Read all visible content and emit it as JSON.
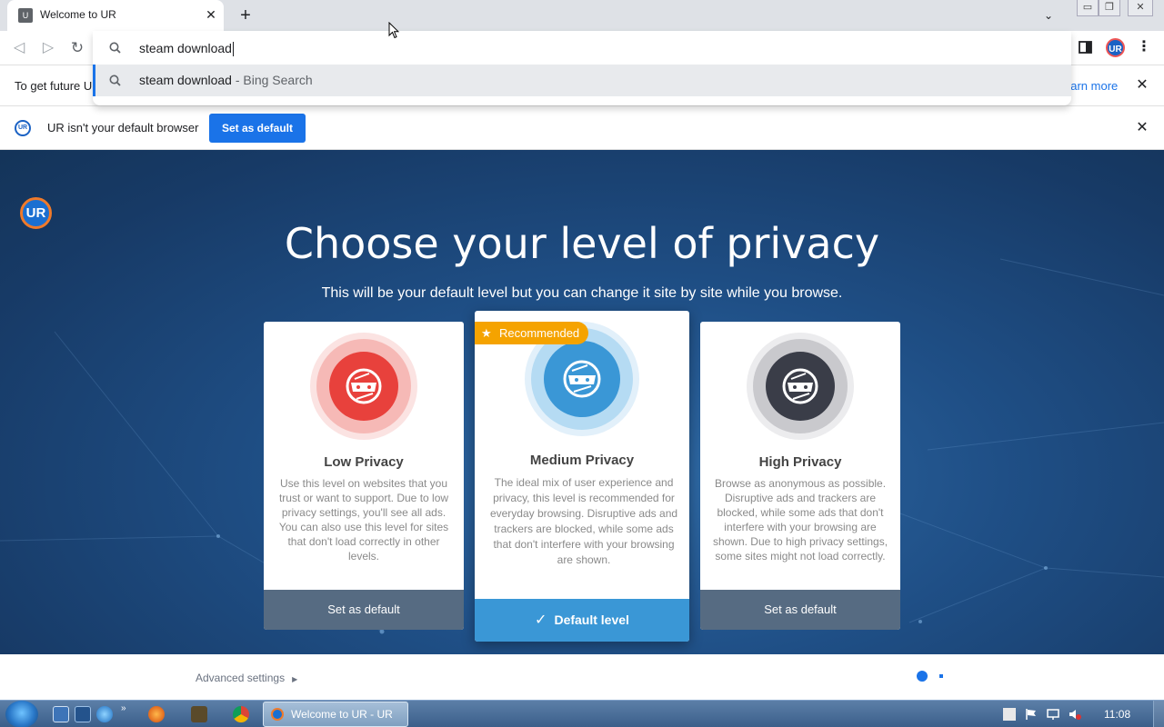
{
  "browser": {
    "tab": {
      "title": "Welcome to UR",
      "favicon": "U"
    },
    "omnibox": {
      "value": "steam download",
      "suggestion": {
        "query": "steam download",
        "source": " - Bing Search"
      }
    },
    "avatar_label": "UR"
  },
  "infobar_1": {
    "text": "To get future U",
    "link": "earn more"
  },
  "infobar_2": {
    "text": "UR isn't your default browser",
    "button": "Set as default"
  },
  "page": {
    "title": "Choose your level of privacy",
    "subtitle": "This will be your default level but you can change it site by site while you browse.",
    "logo_text": "UR",
    "cards": [
      {
        "title": "Low Privacy",
        "description": "Use this level on websites that you trust or want to support. Due to low privacy settings, you'll see all ads. You can also use this level for sites that don't load correctly in other levels.",
        "button": "Set as default",
        "color": "#e8413c"
      },
      {
        "title": "Medium Privacy",
        "badge": "Recommended",
        "description": "The ideal mix of user experience and privacy, this level is recommended for everyday browsing. Disruptive ads and trackers are blocked, while some ads that don't interfere with your browsing are shown.",
        "button": "Default level",
        "color": "#3a97d6"
      },
      {
        "title": "High Privacy",
        "description": "Browse as anonymous as possible. Disruptive ads and trackers are blocked, while some ads that don't interfere with your browsing are shown. Due to high privacy settings, some sites might not load correctly.",
        "button": "Set as default",
        "color": "#3a3d48"
      }
    ],
    "advanced_settings": "Advanced settings"
  },
  "taskbar": {
    "active_window": "Welcome to UR - UR",
    "clock": "11:08"
  },
  "colors": {
    "accent": "#1a73e8",
    "recommended_badge": "#f5a300",
    "background": "#1f4f86"
  }
}
